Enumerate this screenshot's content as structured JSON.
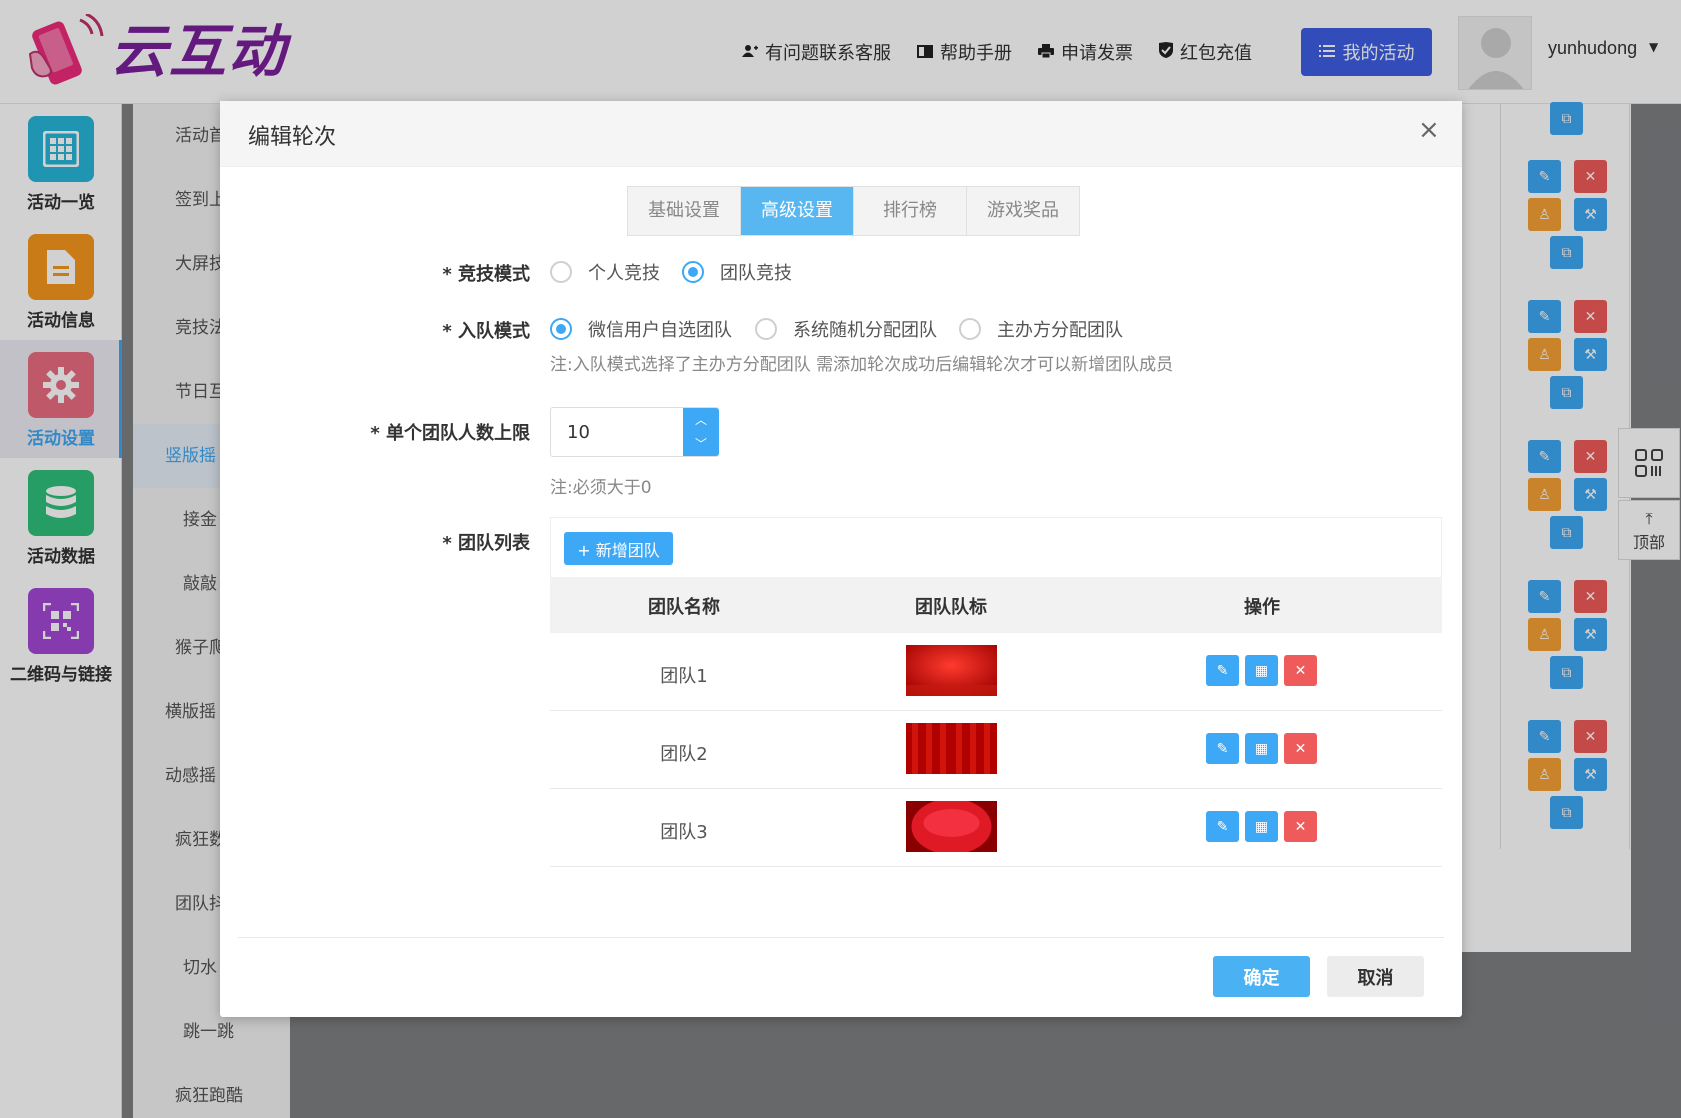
{
  "header": {
    "logo_text": "云互动",
    "links": [
      {
        "label": "有问题联系客服",
        "icon": "add-user-icon"
      },
      {
        "label": "帮助手册",
        "icon": "book-icon"
      },
      {
        "label": "申请发票",
        "icon": "printer-icon"
      },
      {
        "label": "红包充值",
        "icon": "shield-check-icon"
      }
    ],
    "my_activity": "我的活动",
    "username": "yunhudong"
  },
  "nav": {
    "items": [
      {
        "label": "活动一览",
        "icon": "grid-icon",
        "color": "#27b6d8"
      },
      {
        "label": "活动信息",
        "icon": "document-icon",
        "color": "#f5961c"
      },
      {
        "label": "活动设置",
        "icon": "gear-icon",
        "color": "#ea6d82",
        "active": true
      },
      {
        "label": "活动数据",
        "icon": "database-icon",
        "color": "#2fc07a"
      },
      {
        "label": "二维码与链接",
        "icon": "qrcode-icon",
        "color": "#a349d4"
      }
    ]
  },
  "subnav": {
    "items": [
      "活动首",
      "签到上",
      "大屏技",
      "竞技法",
      "节日互",
      "竖版摇",
      "接金",
      "敲敲",
      "猴子爬",
      "横版摇",
      "动感摇",
      "疯狂数",
      "团队抖",
      "切水",
      "跳一跳",
      "疯狂跑酷"
    ],
    "active_index": 5
  },
  "float": {
    "qr_icon": "qrcode-icon",
    "top_arrow": "⤒",
    "top_label": "顶部"
  },
  "modal": {
    "title": "编辑轮次",
    "tabs": [
      "基础设置",
      "高级设置",
      "排行榜",
      "游戏奖品"
    ],
    "active_tab": 1,
    "fields": {
      "mode": {
        "label": "* 竞技模式",
        "options": [
          "个人竞技",
          "团队竞技"
        ],
        "selected": 1
      },
      "join_mode": {
        "label": "* 入队模式",
        "options": [
          "微信用户自选团队",
          "系统随机分配团队",
          "主办方分配团队"
        ],
        "selected": 0,
        "note": "注:入队模式选择了主办方分配团队 需添加轮次成功后编辑轮次才可以新增团队成员"
      },
      "team_limit": {
        "label": "* 单个团队人数上限",
        "value": "10",
        "note": "注:必须大于0"
      },
      "team_list": {
        "label": "* 团队列表",
        "add_button": "+ 新增团队",
        "columns": [
          "团队名称",
          "团队队标",
          "操作"
        ],
        "rows": [
          {
            "name": "团队1",
            "flag": "red-banner-1"
          },
          {
            "name": "团队2",
            "flag": "red-banner-2"
          },
          {
            "name": "团队3",
            "flag": "red-banner-3"
          }
        ]
      }
    },
    "ok": "确定",
    "cancel": "取消",
    "close_icon": "×"
  }
}
